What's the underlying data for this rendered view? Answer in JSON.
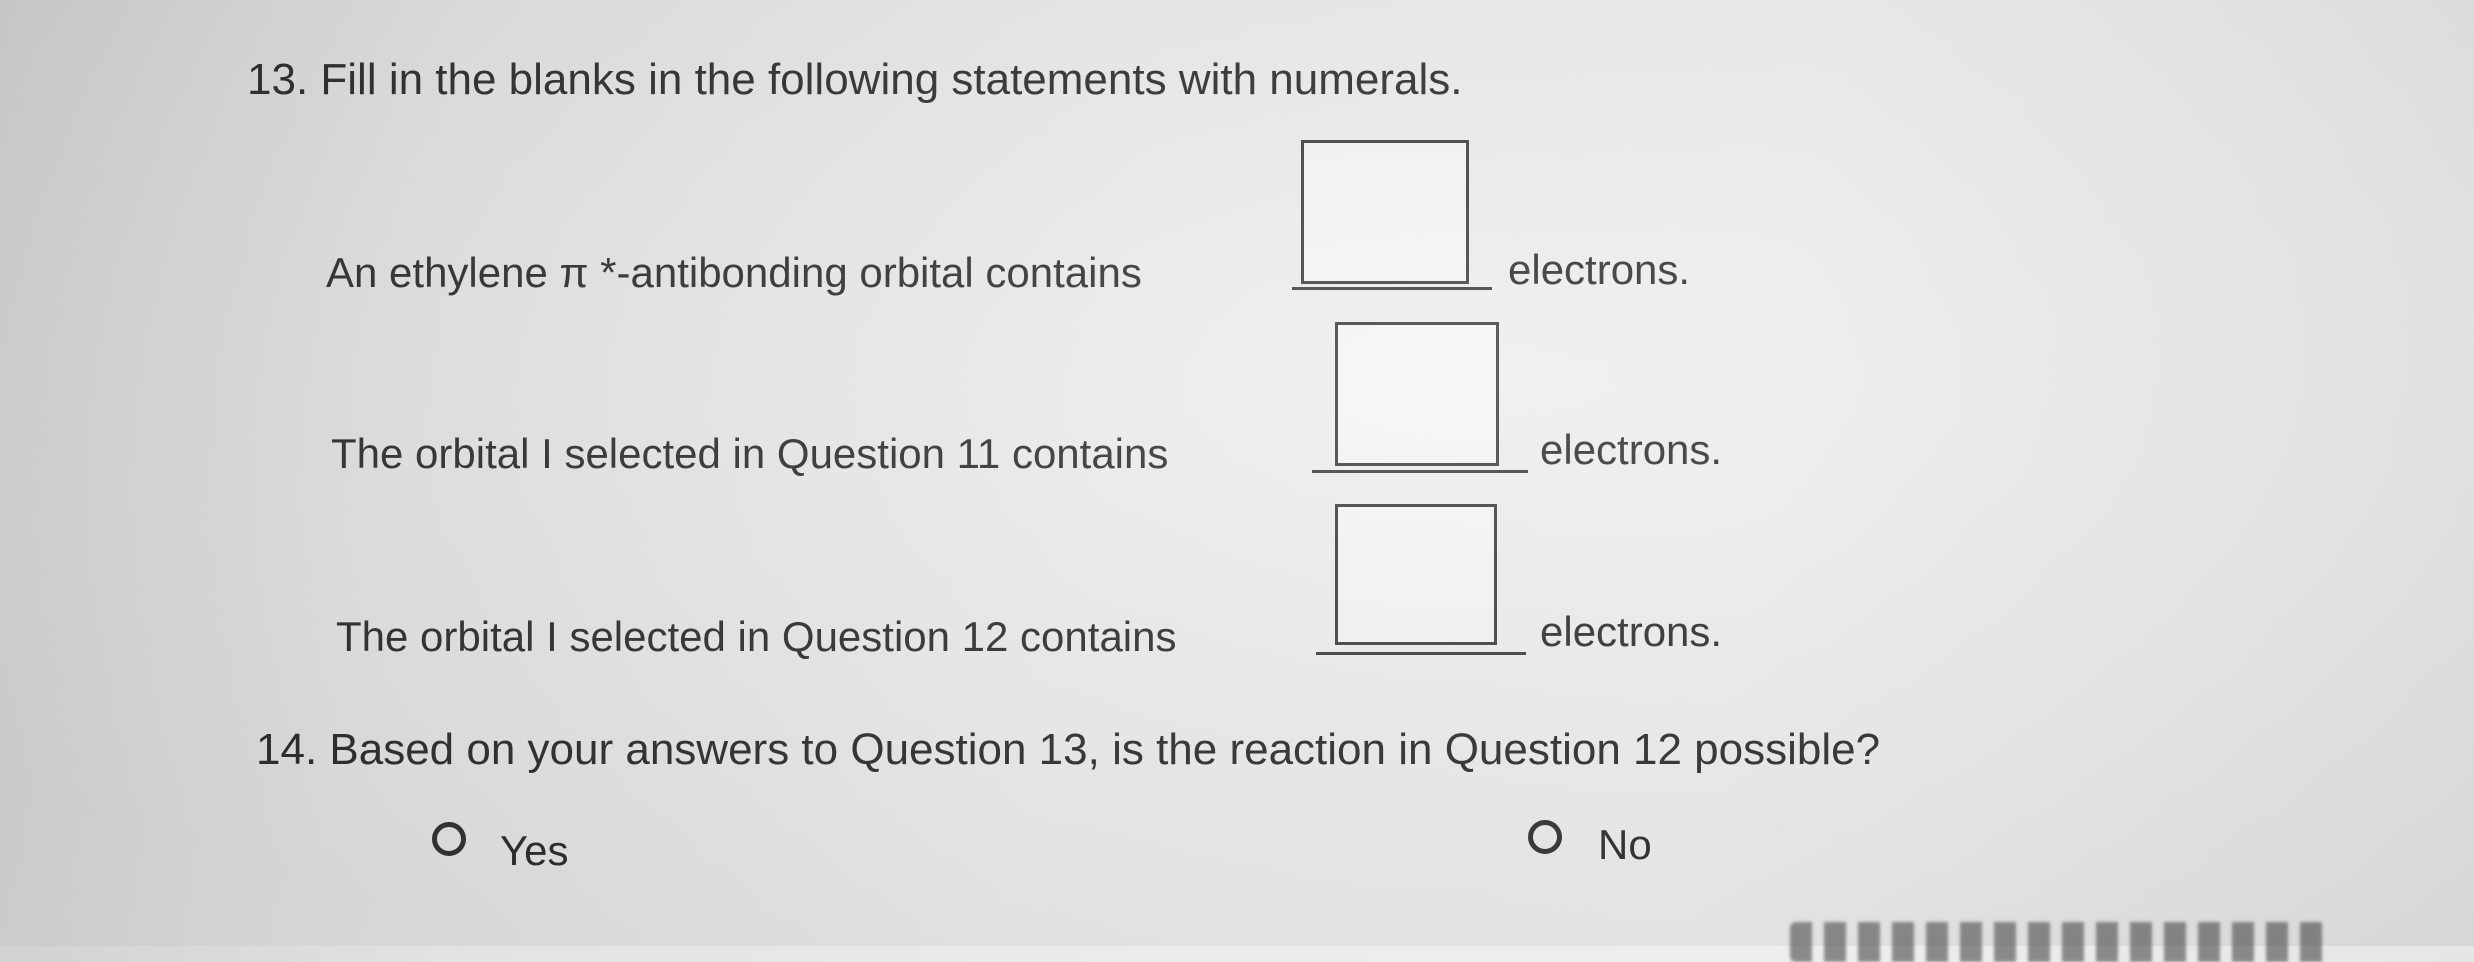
{
  "question13": {
    "title": "13. Fill in the blanks in the following statements with numerals.",
    "statements": [
      {
        "lead": "An ethylene π *-antibonding orbital contains",
        "tail": "electrons.",
        "answer": ""
      },
      {
        "lead": "The orbital I selected in Question 11 contains",
        "tail": "electrons.",
        "answer": ""
      },
      {
        "lead": "The orbital I selected in Question 12 contains",
        "tail": "electrons.",
        "answer": ""
      }
    ]
  },
  "question14": {
    "title": "14. Based on your answers to Question 13, is the reaction in Question 12 possible?",
    "options": [
      {
        "label": "Yes",
        "selected": false
      },
      {
        "label": "No",
        "selected": false
      }
    ]
  }
}
